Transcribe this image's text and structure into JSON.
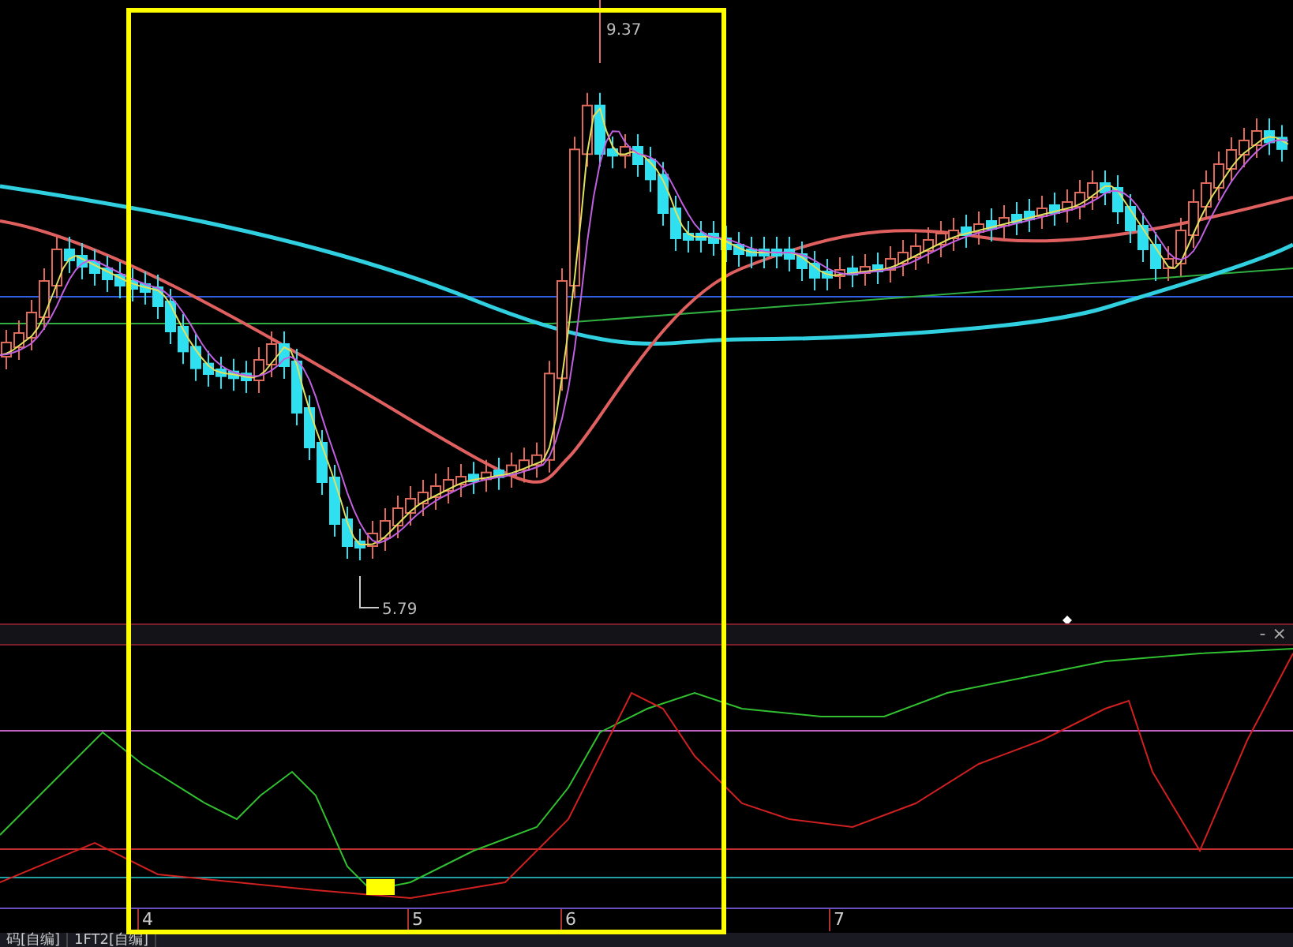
{
  "price_chart": {
    "high_label": "9.37",
    "low_label": "5.79"
  },
  "indicator_panel": {
    "minimize": "-",
    "close": "×"
  },
  "time_axis": [
    {
      "label": "4"
    },
    {
      "label": "5"
    },
    {
      "label": "6"
    },
    {
      "label": "7"
    }
  ],
  "tabs": [
    {
      "label": "码[自编]",
      "selected": false
    },
    {
      "label": "1FT2[自编]",
      "selected": false
    }
  ]
}
